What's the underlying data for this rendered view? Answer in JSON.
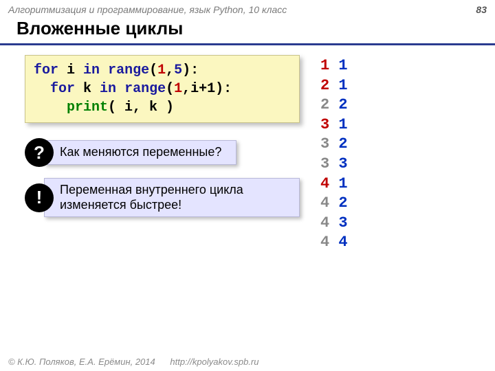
{
  "header": {
    "course": "Алгоритмизация и программирование, язык Python, 10 класс",
    "page_number": "83"
  },
  "title": "Вложенные циклы",
  "code": {
    "line1_for": "for",
    "line1_var": " i ",
    "line1_in": "in",
    "line1_space": " ",
    "line1_range": "range",
    "line1_open": "(",
    "line1_a": "1",
    "line1_comma": ",",
    "line1_b": "5",
    "line1_close": "):",
    "line2_indent": "  ",
    "line2_for": "for",
    "line2_var": " k ",
    "line2_in": "in",
    "line2_space": " ",
    "line2_range": "range",
    "line2_open": "(",
    "line2_a": "1",
    "line2_rest": ",i+1):",
    "line3_indent": "    ",
    "line3_print": "print",
    "line3_args": "( i, k )"
  },
  "callouts": {
    "question_badge": "?",
    "question_text": "Как меняются переменные?",
    "exclaim_badge": "!",
    "exclaim_text": "Переменная внутреннего цикла изменяется быстрее!"
  },
  "output": [
    {
      "i": "1",
      "k": "1",
      "first": true
    },
    {
      "i": "2",
      "k": "1",
      "first": true
    },
    {
      "i": "2",
      "k": "2",
      "first": false
    },
    {
      "i": "3",
      "k": "1",
      "first": true
    },
    {
      "i": "3",
      "k": "2",
      "first": false
    },
    {
      "i": "3",
      "k": "3",
      "first": false
    },
    {
      "i": "4",
      "k": "1",
      "first": true
    },
    {
      "i": "4",
      "k": "2",
      "first": false
    },
    {
      "i": "4",
      "k": "3",
      "first": false
    },
    {
      "i": "4",
      "k": "4",
      "first": false
    }
  ],
  "footer": {
    "copyright": "© К.Ю. Поляков, Е.А. Ерёмин, 2014",
    "url": "http://kpolyakov.spb.ru"
  }
}
